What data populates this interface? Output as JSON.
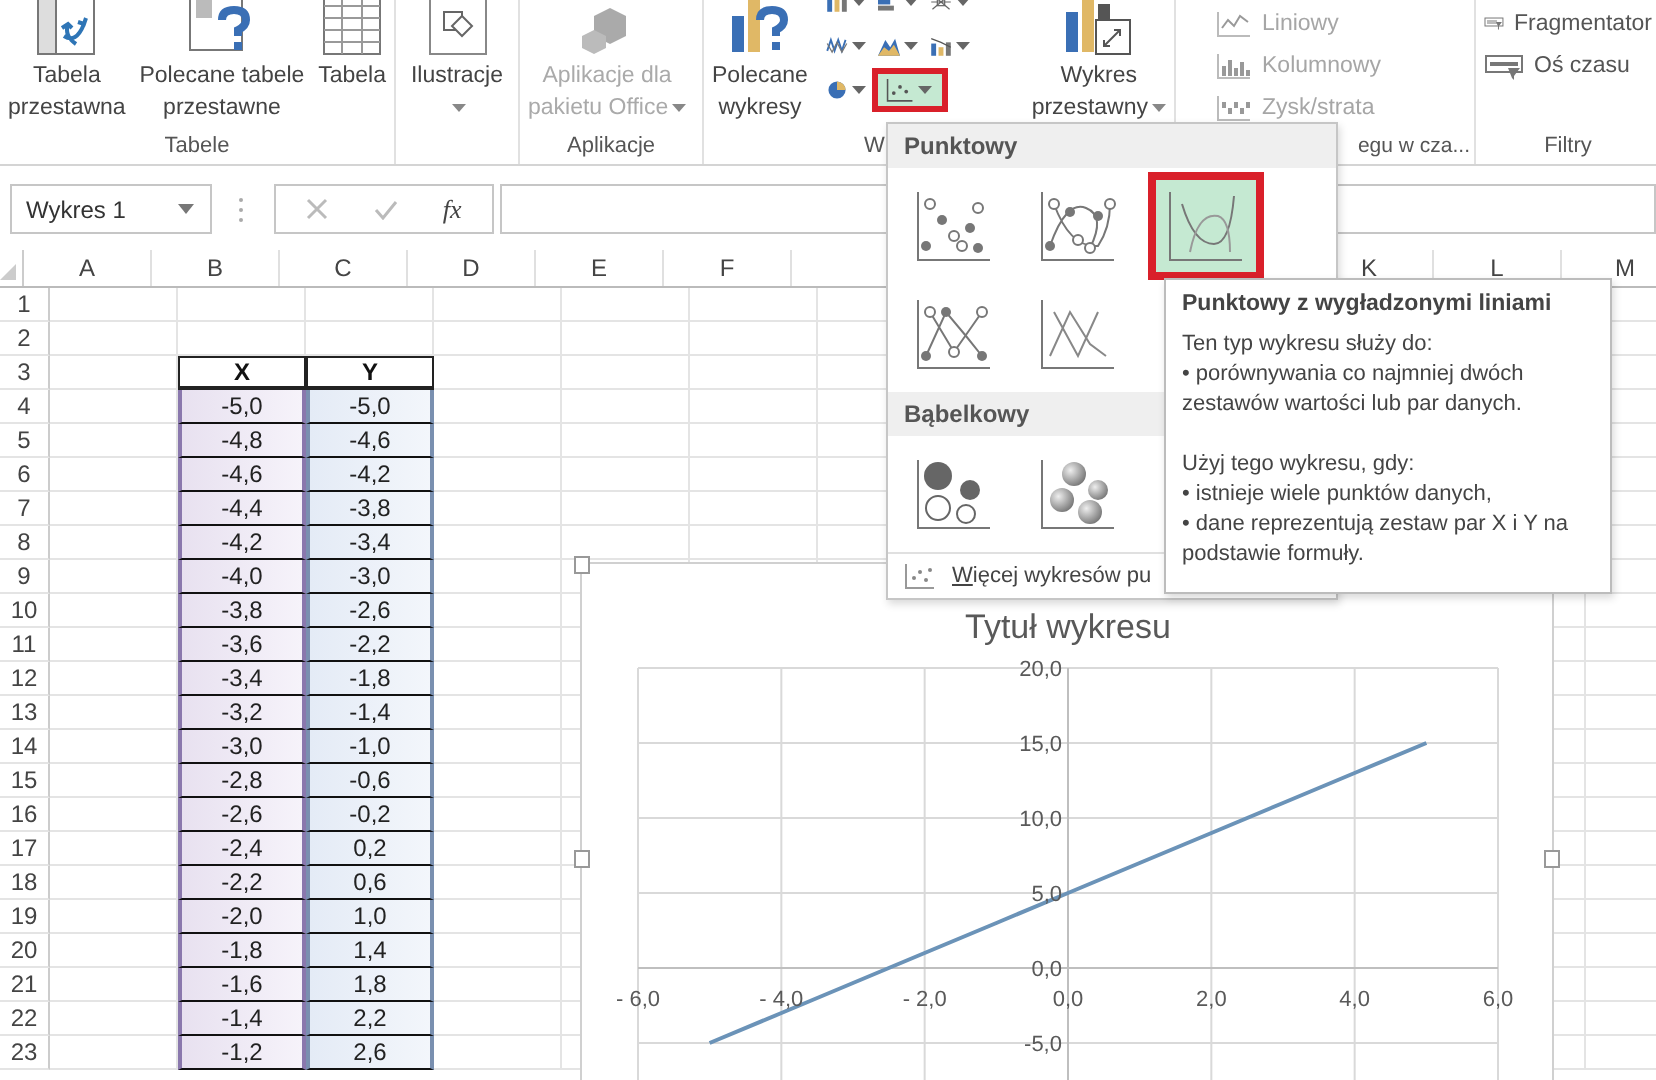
{
  "ribbon": {
    "groups": [
      {
        "label": "Tabele",
        "items": [
          {
            "kind": "large",
            "label": "Tabela\nprzestawna",
            "disabled": false,
            "menu": false
          },
          {
            "kind": "large",
            "label": "Polecane tabele\nprzestawne",
            "disabled": false,
            "menu": false
          },
          {
            "kind": "large",
            "label": "Tabela",
            "disabled": false,
            "menu": false
          }
        ]
      },
      {
        "items": [
          {
            "kind": "large",
            "label": "Ilustracje",
            "disabled": false,
            "menu": true
          }
        ]
      },
      {
        "label": "Aplikacje",
        "items": [
          {
            "kind": "large",
            "label": "Aplikacje dla\npakietu Office",
            "disabled": true,
            "menu": true
          }
        ]
      },
      {
        "label": "W",
        "items": [
          {
            "kind": "large",
            "label": "Polecane\nwykresy",
            "disabled": false,
            "menu": false
          },
          {
            "kind": "grid",
            "buttons": [
              {
                "selected": false
              },
              {
                "selected": false
              },
              {
                "selected": false
              },
              {
                "selected": false
              },
              {
                "selected": false
              },
              {
                "selected": false
              },
              {
                "selected": false
              },
              {
                "selected": true
              }
            ]
          },
          {
            "kind": "large",
            "label": "Wykres\nprzestawny",
            "disabled": false,
            "menu": true
          }
        ]
      },
      {
        "label": "egu w cza...",
        "items": [
          {
            "kind": "small",
            "label": "Liniowy",
            "disabled": true
          },
          {
            "kind": "small",
            "label": "Kolumnowy",
            "disabled": true
          },
          {
            "kind": "small",
            "label": "Zysk/strata",
            "disabled": true
          }
        ]
      },
      {
        "label": "Filtry",
        "items": [
          {
            "kind": "small",
            "label": "Fragmentator",
            "disabled": false
          },
          {
            "kind": "small",
            "label": "Oś czasu",
            "disabled": false
          }
        ]
      }
    ]
  },
  "formula_bar": {
    "name_box": "Wykres 1",
    "function_button": "fx"
  },
  "sheet": {
    "columns": [
      "A",
      "B",
      "C",
      "D",
      "E",
      "F",
      "K",
      "L",
      "M"
    ],
    "row_numbers": [
      "1",
      "2",
      "3",
      "4",
      "5",
      "6",
      "7",
      "8",
      "9",
      "10",
      "11",
      "12",
      "13",
      "14",
      "15",
      "16",
      "17",
      "18",
      "19",
      "20",
      "21",
      "22",
      "23"
    ]
  },
  "table": {
    "columns": [
      "X",
      "Y"
    ],
    "rows": [
      [
        "-5,0",
        "-5,0"
      ],
      [
        "-4,8",
        "-4,6"
      ],
      [
        "-4,6",
        "-4,2"
      ],
      [
        "-4,4",
        "-3,8"
      ],
      [
        "-4,2",
        "-3,4"
      ],
      [
        "-4,0",
        "-3,0"
      ],
      [
        "-3,8",
        "-2,6"
      ],
      [
        "-3,6",
        "-2,2"
      ],
      [
        "-3,4",
        "-1,8"
      ],
      [
        "-3,2",
        "-1,4"
      ],
      [
        "-3,0",
        "-1,0"
      ],
      [
        "-2,8",
        "-0,6"
      ],
      [
        "-2,6",
        "-0,2"
      ],
      [
        "-2,4",
        "0,2"
      ],
      [
        "-2,2",
        "0,6"
      ],
      [
        "-2,0",
        "1,0"
      ],
      [
        "-1,8",
        "1,4"
      ],
      [
        "-1,6",
        "1,8"
      ],
      [
        "-1,4",
        "2,2"
      ],
      [
        "-1,2",
        "2,6"
      ]
    ]
  },
  "chart": {
    "chart_data": {
      "type": "line",
      "title": "Tytuł wykresu",
      "x": [
        -5,
        -4,
        -3,
        -2,
        -1,
        0,
        1,
        2,
        3,
        4,
        5
      ],
      "series": [
        {
          "color": "#6b93b8",
          "values": [
            -5,
            -3,
            -1,
            1,
            3,
            5,
            7,
            9,
            11,
            13,
            15
          ]
        }
      ],
      "xlim": [
        -6,
        6
      ],
      "ylim": [
        -7.5,
        20
      ],
      "grid": true,
      "xticks": [
        {
          "value": -6,
          "label": "- 6,0"
        },
        {
          "value": -4,
          "label": "- 4,0"
        },
        {
          "value": -2,
          "label": "- 2,0"
        },
        {
          "value": 0,
          "label": "0,0"
        },
        {
          "value": 2,
          "label": "2,0"
        },
        {
          "value": 4,
          "label": "4,0"
        },
        {
          "value": 6,
          "label": "6,0"
        }
      ],
      "yticks": [
        {
          "value": -5,
          "label": "-5,0"
        },
        {
          "value": 0,
          "label": "0,0"
        },
        {
          "value": 5,
          "label": "5,0"
        },
        {
          "value": 10,
          "label": "10,0"
        },
        {
          "value": 15,
          "label": "15,0"
        },
        {
          "value": 20,
          "label": "20,0"
        }
      ]
    }
  },
  "chart_menu": {
    "sections": [
      {
        "title": "Punktowy",
        "options": [
          {
            "kind": "markers",
            "selected": false
          },
          {
            "kind": "smooth-markers",
            "selected": false
          },
          {
            "kind": "smooth-lines",
            "selected": true
          },
          {
            "kind": "straight-markers",
            "selected": false
          },
          {
            "kind": "straight-lines",
            "selected": false
          }
        ]
      },
      {
        "title": "Bąbelkowy",
        "options": [
          {
            "kind": "bubble",
            "selected": false
          },
          {
            "kind": "bubble-3d",
            "selected": false
          }
        ]
      }
    ],
    "more": "Więcej wykresów pu"
  },
  "tooltip": {
    "title": "Punktowy z wygładzonymi liniami",
    "paragraphs": [
      [
        "Ten typ wykresu służy do:",
        "• porównywania co najmniej dwóch zestawów wartości lub par danych."
      ],
      [
        "Użyj tego wykresu, gdy:",
        "• istnieje wiele punktów danych,",
        "• dane reprezentują zestaw par X i Y na podstawie formuły."
      ]
    ]
  }
}
